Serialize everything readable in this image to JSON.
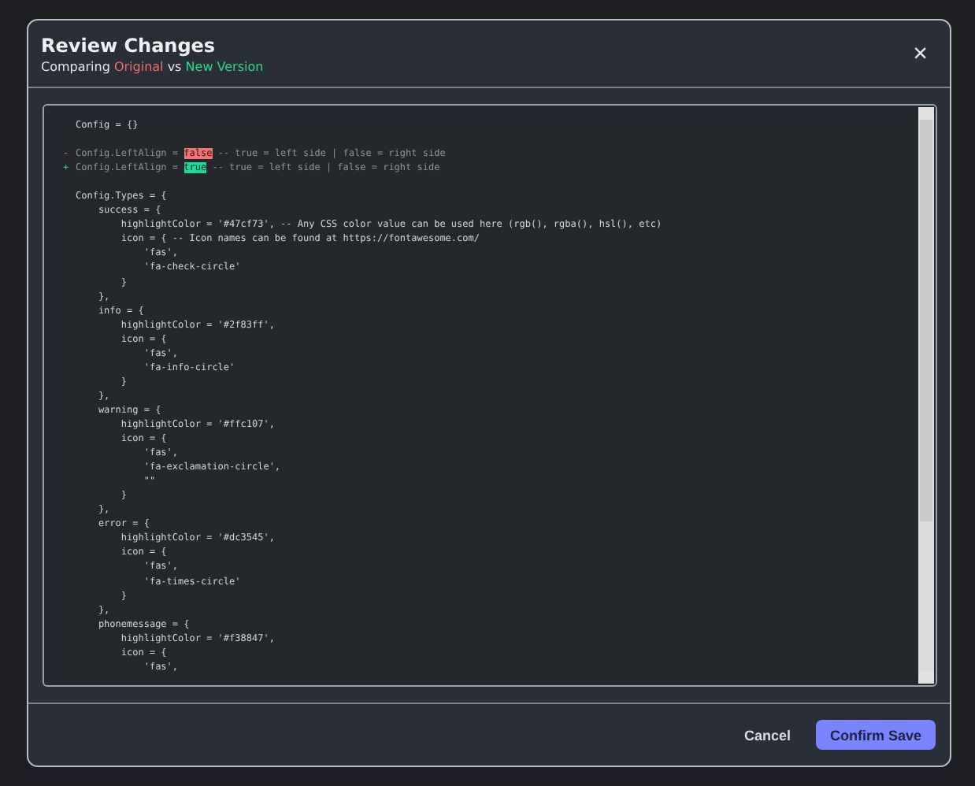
{
  "dialog": {
    "title": "Review Changes",
    "subtitle": {
      "prefix": "Comparing ",
      "original": "Original",
      "separator": " vs ",
      "new": "New Version"
    },
    "close": "×"
  },
  "code_lines": [
    {
      "kind": "context",
      "text": "Config = {}"
    },
    {
      "kind": "blank"
    },
    {
      "kind": "removed",
      "marker": "-",
      "before": "Config.LeftAlign = ",
      "highlight": "false",
      "after": " -- true = left side | false = right side"
    },
    {
      "kind": "added",
      "marker": "+",
      "before": "Config.LeftAlign = ",
      "highlight": "true",
      "after": " -- true = left side | false = right side"
    },
    {
      "kind": "blank"
    },
    {
      "kind": "context",
      "text": "Config.Types = {"
    },
    {
      "kind": "context",
      "text": "    success = {"
    },
    {
      "kind": "context",
      "text": "        highlightColor = '#47cf73', -- Any CSS color value can be used here (rgb(), rgba(), hsl(), etc)"
    },
    {
      "kind": "context",
      "text": "        icon = { -- Icon names can be found at https://fontawesome.com/"
    },
    {
      "kind": "context",
      "text": "            'fas',"
    },
    {
      "kind": "context",
      "text": "            'fa-check-circle'"
    },
    {
      "kind": "context",
      "text": "        }"
    },
    {
      "kind": "context",
      "text": "    },"
    },
    {
      "kind": "context",
      "text": "    info = {"
    },
    {
      "kind": "context",
      "text": "        highlightColor = '#2f83ff',"
    },
    {
      "kind": "context",
      "text": "        icon = {"
    },
    {
      "kind": "context",
      "text": "            'fas',"
    },
    {
      "kind": "context",
      "text": "            'fa-info-circle'"
    },
    {
      "kind": "context",
      "text": "        }"
    },
    {
      "kind": "context",
      "text": "    },"
    },
    {
      "kind": "context",
      "text": "    warning = {"
    },
    {
      "kind": "context",
      "text": "        highlightColor = '#ffc107',"
    },
    {
      "kind": "context",
      "text": "        icon = {"
    },
    {
      "kind": "context",
      "text": "            'fas',"
    },
    {
      "kind": "context",
      "text": "            'fa-exclamation-circle',"
    },
    {
      "kind": "context",
      "text": "            \"\""
    },
    {
      "kind": "context",
      "text": "        }"
    },
    {
      "kind": "context",
      "text": "    },"
    },
    {
      "kind": "context",
      "text": "    error = {"
    },
    {
      "kind": "context",
      "text": "        highlightColor = '#dc3545',"
    },
    {
      "kind": "context",
      "text": "        icon = {"
    },
    {
      "kind": "context",
      "text": "            'fas',"
    },
    {
      "kind": "context",
      "text": "            'fa-times-circle'"
    },
    {
      "kind": "context",
      "text": "        }"
    },
    {
      "kind": "context",
      "text": "    },"
    },
    {
      "kind": "context",
      "text": "    phonemessage = {"
    },
    {
      "kind": "context",
      "text": "        highlightColor = '#f38847',"
    },
    {
      "kind": "context",
      "text": "        icon = {"
    },
    {
      "kind": "context",
      "text": "            'fas',"
    }
  ],
  "buttons": [
    {
      "kind": "secondary",
      "label": "Cancel"
    },
    {
      "kind": "primary",
      "label": "Confirm Save"
    }
  ]
}
